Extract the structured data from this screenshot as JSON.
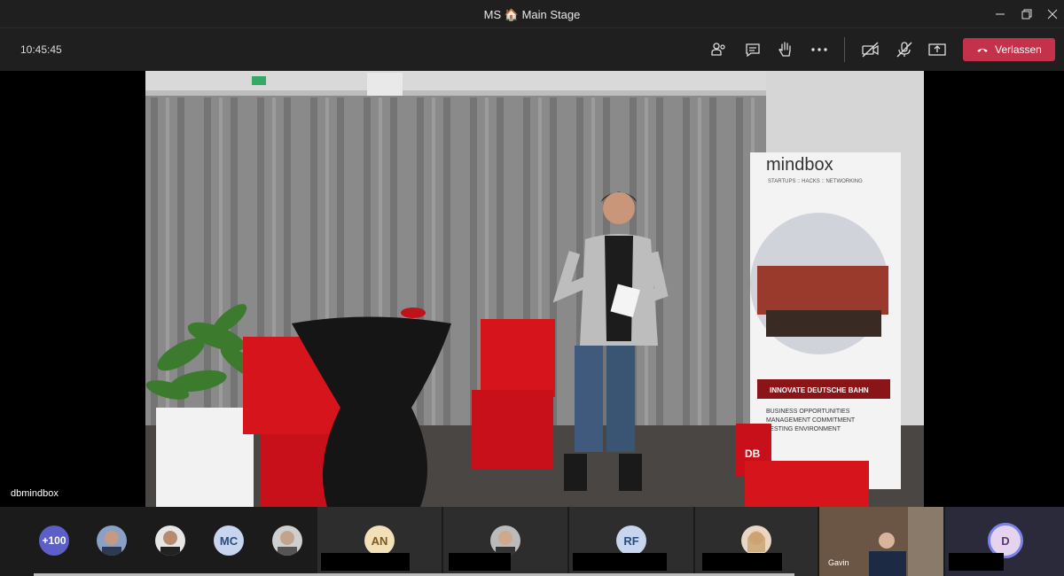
{
  "window": {
    "title": "MS 🏠 Main Stage",
    "controls": [
      "minimize",
      "maximize",
      "close"
    ]
  },
  "toolbar": {
    "time": "10:45:45",
    "icons": [
      "participants-icon",
      "chat-icon",
      "raise-hand-icon",
      "more-icon",
      "camera-off-icon",
      "mic-off-icon",
      "share-icon"
    ],
    "leave_label": "Verlassen",
    "leave_color": "#c4314b"
  },
  "stage": {
    "speaker_name": "dbmindbox",
    "banner_brand": "mindbox",
    "banner_tagline": "STARTUPS :: HACKS :: NETWORKING",
    "banner_ribbon": "INNOVATE DEUTSCHE BAHN",
    "banner_lines": [
      "BUSINESS OPPORTUNITIES",
      "MANAGEMENT COMMITMENT",
      "TESTING ENVIRONMENT"
    ],
    "banner_logo": "DB"
  },
  "gallery": {
    "overflow_count": "+100",
    "initials": [
      "MC",
      "AN",
      "RF",
      "D"
    ],
    "participant_video_name": "Gavin"
  }
}
